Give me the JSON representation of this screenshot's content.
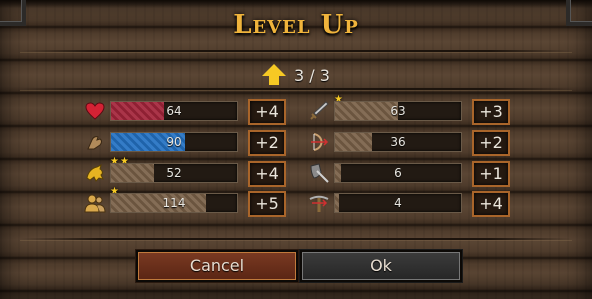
{
  "dialog": {
    "title": "Level Up",
    "progress": "3 / 3"
  },
  "left_stats": [
    {
      "icon": "heart-icon",
      "stars": 0,
      "value": "64",
      "fill": 0.42,
      "color": "#a3243a",
      "increase": "+4"
    },
    {
      "icon": "muscle-icon",
      "stars": 0,
      "value": "90",
      "fill": 0.59,
      "color": "#2371c2",
      "increase": "+2"
    },
    {
      "icon": "lion-icon",
      "stars": 2,
      "value": "52",
      "fill": 0.34,
      "color": "#7a6148",
      "increase": "+4"
    },
    {
      "icon": "group-icon",
      "stars": 1,
      "value": "114",
      "fill": 0.75,
      "color": "#7a6148",
      "increase": "+5"
    }
  ],
  "right_stats": [
    {
      "icon": "sword-icon",
      "stars": 1,
      "value": "63",
      "fill": 0.5,
      "color": "#7a6148",
      "increase": "+3"
    },
    {
      "icon": "bow-icon",
      "stars": 0,
      "value": "36",
      "fill": 0.29,
      "color": "#7a6148",
      "increase": "+2"
    },
    {
      "icon": "shield-sword-icon",
      "stars": 0,
      "value": "6",
      "fill": 0.05,
      "color": "#7a6148",
      "increase": "+1"
    },
    {
      "icon": "crossbow-icon",
      "stars": 0,
      "value": "4",
      "fill": 0.03,
      "color": "#7a6148",
      "increase": "+4"
    }
  ],
  "buttons": {
    "cancel": "Cancel",
    "ok": "Ok"
  }
}
